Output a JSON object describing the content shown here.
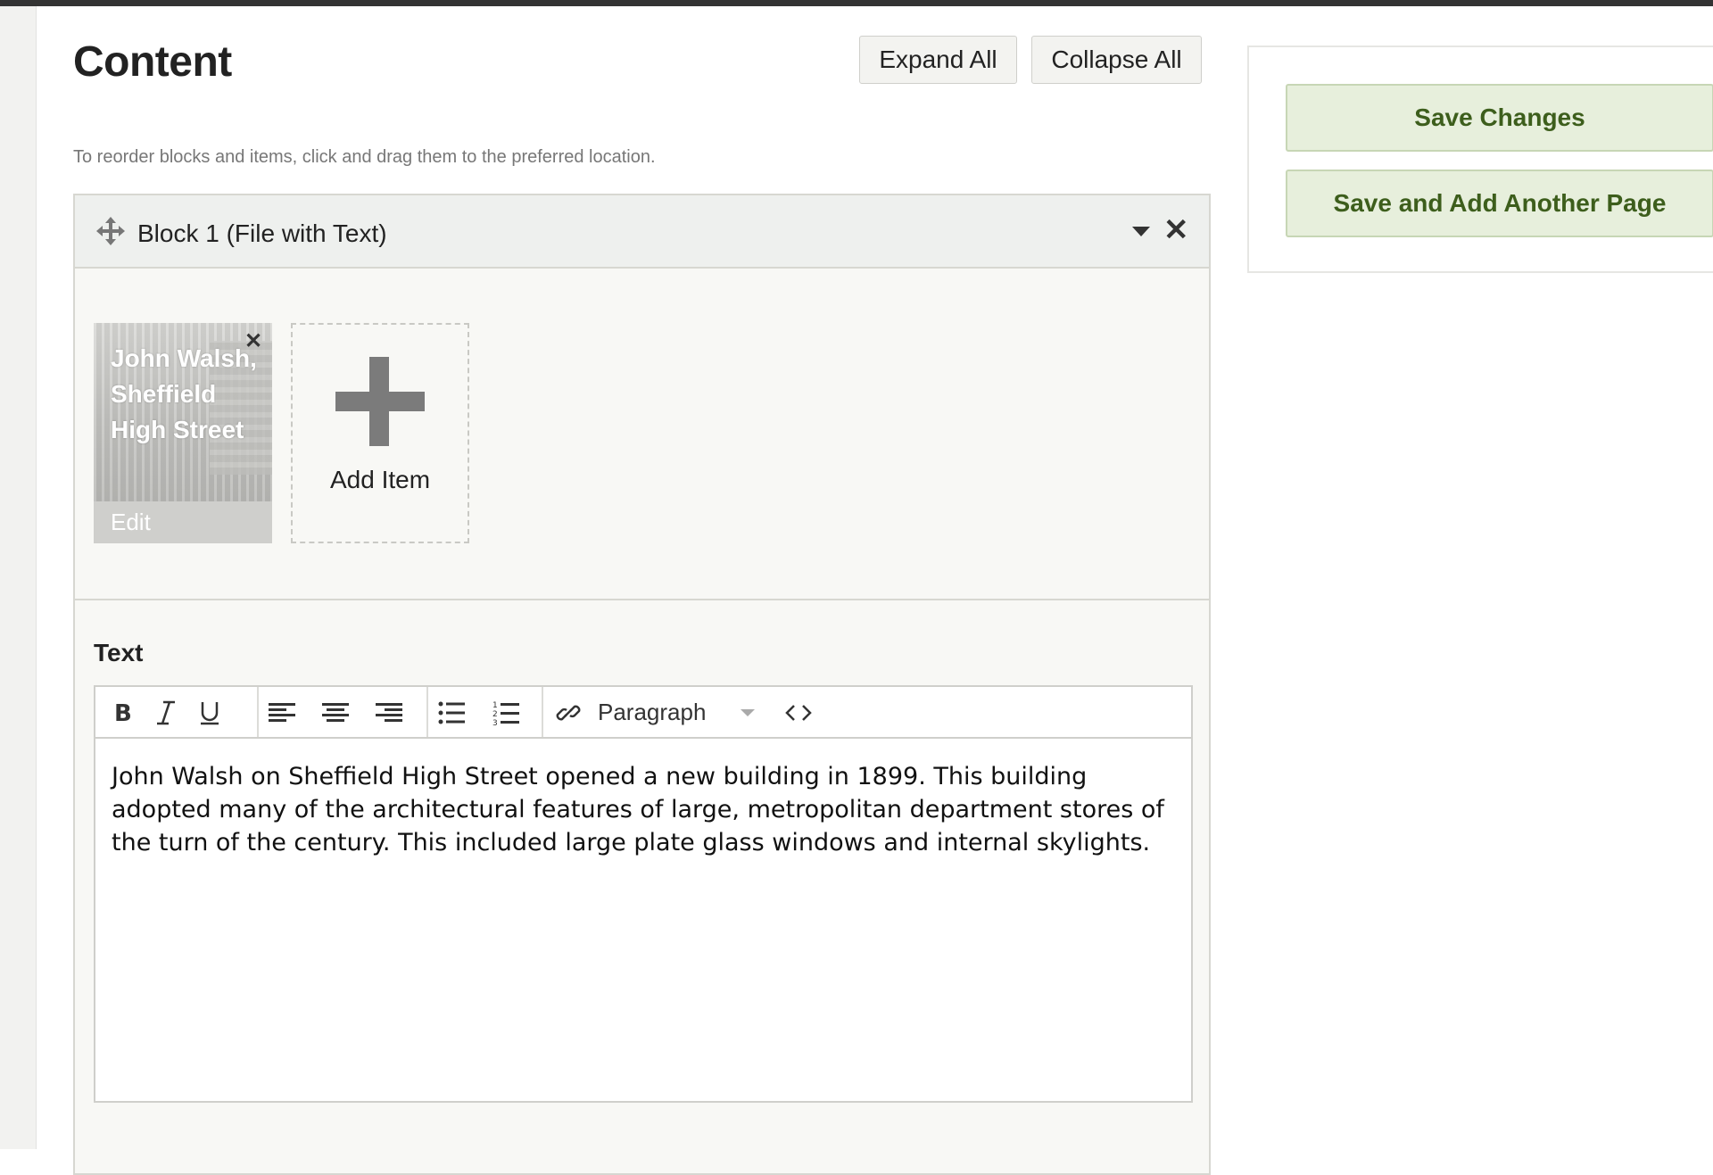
{
  "page": {
    "title": "Content",
    "instructions": "To reorder blocks and items, click and drag them to the preferred location."
  },
  "header_buttons": {
    "expand_all": "Expand All",
    "collapse_all": "Collapse All"
  },
  "block": {
    "title": "Block 1 (File with Text)",
    "items": [
      {
        "caption": "John Walsh, Sheffield High Street",
        "edit_label": "Edit"
      }
    ],
    "add_item_label": "Add Item",
    "text_label": "Text",
    "editor": {
      "format_select": "Paragraph",
      "content": "John Walsh on Sheffield High Street opened a new building in 1899. This building adopted many of the architectural features of large, metropolitan department stores of the turn of the century. This included large plate glass windows and internal skylights."
    }
  },
  "sidebar": {
    "save_label": "Save Changes",
    "save_add_label": "Save and Add Another Page"
  },
  "colors": {
    "save_bg": "#e7efdc",
    "save_text": "#3d5e1c",
    "top_bar": "#333333"
  }
}
